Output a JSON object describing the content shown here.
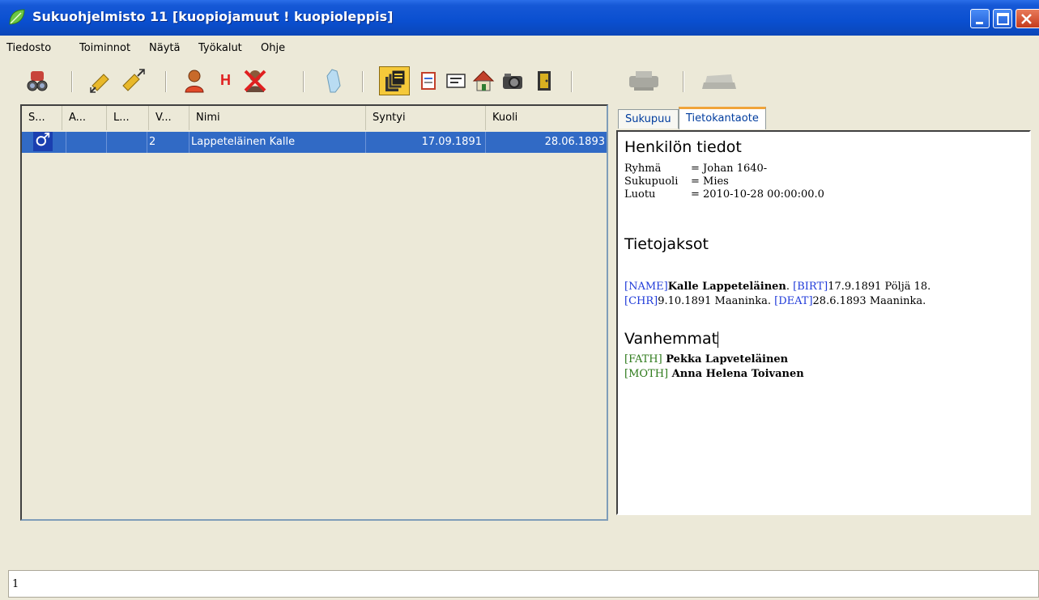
{
  "window": {
    "title": "Sukuohjelmisto 11 [kuopiojamuut ! kuopioleppis]"
  },
  "menu": [
    "Tiedosto",
    "Toiminnot",
    "Näytä",
    "Työkalut",
    "Ohje"
  ],
  "toolbar": {
    "icons": [
      "binoculars-icon",
      "pin-in-icon",
      "pin-out-icon",
      "person-icon",
      "h-icon",
      "person-delete-icon",
      "map-icon",
      "stacked-docs-icon",
      "document-icon",
      "card-icon",
      "house-icon",
      "camera-icon",
      "door-icon",
      "print-disabled-icon",
      "scanner-disabled-icon"
    ],
    "h_label": "H"
  },
  "list": {
    "columns": [
      "S...",
      "A...",
      "L...",
      "V...",
      "Nimi",
      "Syntyi",
      "Kuoli"
    ],
    "rows": [
      {
        "sex_icon": "male-icon",
        "sex_symbol": "♂",
        "a": "",
        "l": "",
        "v": "2",
        "name": "Lappeteläinen Kalle",
        "born": "17.09.1891",
        "died": "28.06.1893"
      }
    ]
  },
  "tabs": [
    "Sukupuu",
    "Tietokantaote"
  ],
  "active_tab": "Tietokantaote",
  "document": {
    "person_heading": "Henkilön tiedot",
    "fields": [
      {
        "key": "Ryhmä",
        "value": "= Johan 1640-"
      },
      {
        "key": "Sukupuoli",
        "value": "= Mies"
      },
      {
        "key": "Luotu",
        "value": "= 2010-10-28 00:00:00.0"
      }
    ],
    "sections_heading": "Tietojaksot",
    "line1": {
      "tag_name": "[NAME]",
      "name": "Kalle Lappeteläinen",
      "sep1": ". ",
      "tag_birt": "[BIRT]",
      "birt": "17.9.1891 Pöljä 18."
    },
    "line2": {
      "tag_chr": "[CHR]",
      "chr": "9.10.1891 Maaninka. ",
      "tag_deat": "[DEAT]",
      "deat": "28.6.1893 Maaninka."
    },
    "parents_heading": "Vanhemmat",
    "father_tag": "[FATH]",
    "father": " Pekka Lapveteläinen",
    "mother_tag": "[MOTH]",
    "mother": " Anna Helena Toivanen"
  },
  "status": {
    "text": "1"
  }
}
